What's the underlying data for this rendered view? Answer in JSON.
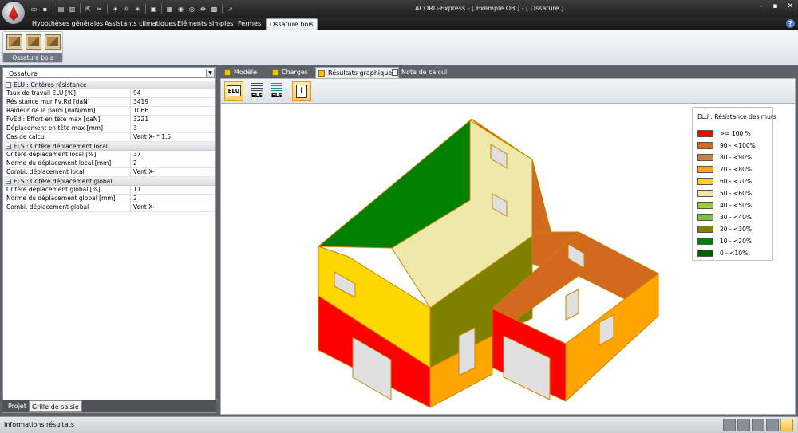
{
  "window": {
    "title": "ACORD-Express - [ Exemple OB ] - [ Ossature ]"
  },
  "ribbon": {
    "tabs": [
      "Hypothèses générales",
      "Assistants climatiques",
      "Eléments simples",
      "Fermes",
      "Ossature bois"
    ],
    "active_tab": "Ossature bois",
    "group_label": "Ossature bois"
  },
  "left_panel": {
    "selector_value": "Ossature",
    "sections": [
      {
        "title": "ELU : Critères résistance",
        "rows": [
          {
            "label": "Taux de travail ELU  [%]",
            "value": "94"
          },
          {
            "label": "Résistance mur Fv,Rd  [daN]",
            "value": "3419"
          },
          {
            "label": "Raideur de la paroi  [daN/mm]",
            "value": "1066"
          },
          {
            "label": "FvEd : Effort en tête max   [daN]",
            "value": "3221"
          },
          {
            "label": "Déplacement en tête max  [mm]",
            "value": "3"
          },
          {
            "label": "Cas de calcul",
            "value": "Vent X- * 1.5"
          }
        ]
      },
      {
        "title": "ELS : Critère déplacement local",
        "rows": [
          {
            "label": "Critère déplacement local  [%]",
            "value": "37"
          },
          {
            "label": "Norme du déplacement local   [mm]",
            "value": "2"
          },
          {
            "label": "Combi. déplacement local",
            "value": "Vent X-"
          }
        ]
      },
      {
        "title": "ELS : Critère déplacement global",
        "rows": [
          {
            "label": "Critère déplacement global  [%]",
            "value": "11"
          },
          {
            "label": "Norme du déplacement global   [mm]",
            "value": "2"
          },
          {
            "label": "Combi. déplacement global",
            "value": "Vent X-"
          }
        ]
      }
    ],
    "bottom_tabs": [
      "Projet",
      "Grille de saisie"
    ]
  },
  "view_tabs": [
    "Modèle",
    "Charges",
    "Résultats graphiques",
    "Note de calcul"
  ],
  "active_view_tab": "Résultats graphiques",
  "result_buttons": {
    "elu": "ELU",
    "els_local": "ELS",
    "els_global": "ELS"
  },
  "legend": {
    "title": "ELU : Résistance des murs",
    "entries": [
      {
        "label": ">= 100 %",
        "color": "#ff0000"
      },
      {
        "label": "90 - <100%",
        "color": "#d2691e"
      },
      {
        "label": "80 - <90%",
        "color": "#c8844a"
      },
      {
        "label": "70 - <80%",
        "color": "#ffa500"
      },
      {
        "label": "60 - <70%",
        "color": "#ffd700"
      },
      {
        "label": "50 - <60%",
        "color": "#eee8aa"
      },
      {
        "label": "40 - <50%",
        "color": "#9acd32"
      },
      {
        "label": "30 - <40%",
        "color": "#7fbf3f"
      },
      {
        "label": "20 - <30%",
        "color": "#808000"
      },
      {
        "label": "10 - <20%",
        "color": "#008000"
      },
      {
        "label": "0 - <10%",
        "color": "#006400"
      }
    ]
  },
  "status": {
    "text": "Informations résultats"
  }
}
